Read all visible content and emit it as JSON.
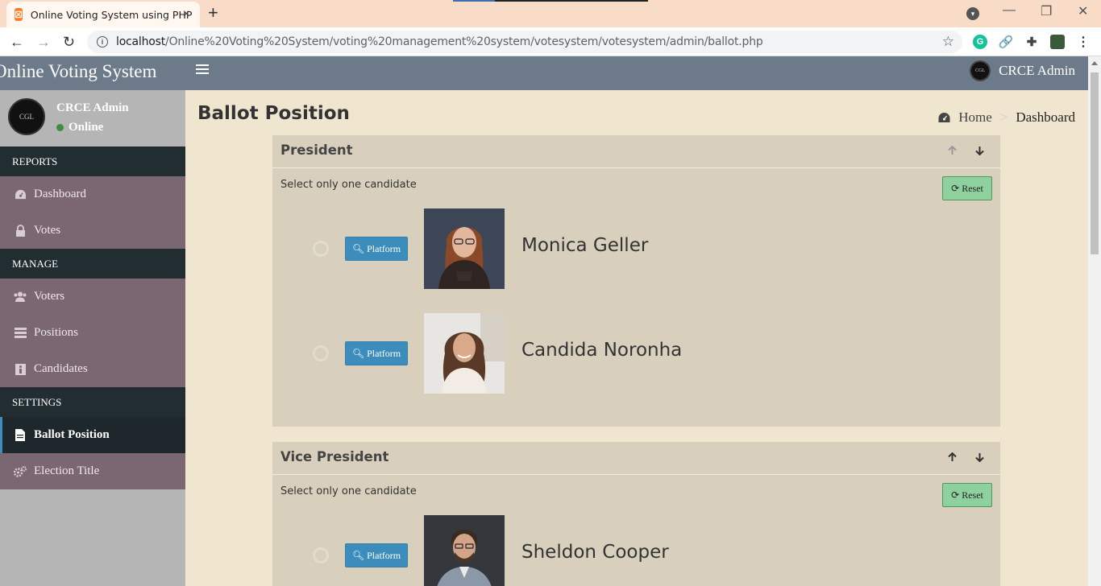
{
  "browser": {
    "tab_title": "Online Voting System using PHP",
    "url_host": "localhost",
    "url_path": "/Online%20Voting%20System/voting%20management%20system/votesystem/votesystem/admin/ballot.php"
  },
  "header": {
    "logo_text": "Online Voting System",
    "user_name": "CRCE Admin",
    "avatar_text": "CGL"
  },
  "sidebar": {
    "user_name": "CRCE Admin",
    "status": "Online",
    "avatar_text": "CGL",
    "sections": [
      {
        "title": "REPORTS",
        "items": [
          {
            "label": "Dashboard",
            "icon": "dashboard-icon"
          },
          {
            "label": "Votes",
            "icon": "lock-icon"
          }
        ]
      },
      {
        "title": "MANAGE",
        "items": [
          {
            "label": "Voters",
            "icon": "users-icon"
          },
          {
            "label": "Positions",
            "icon": "tasks-icon"
          },
          {
            "label": "Candidates",
            "icon": "id-card-icon"
          }
        ]
      },
      {
        "title": "SETTINGS",
        "items": [
          {
            "label": "Ballot Position",
            "icon": "file-icon"
          },
          {
            "label": "Election Title",
            "icon": "cogs-icon"
          }
        ]
      }
    ]
  },
  "content": {
    "title": "Ballot Position",
    "breadcrumb": {
      "home": "Home",
      "current": "Dashboard"
    }
  },
  "positions": [
    {
      "title": "President",
      "instructions": "Select only one candidate",
      "reset_label": "Reset",
      "candidates": [
        {
          "name": "Monica Geller",
          "platform_label": "Platform"
        },
        {
          "name": "Candida Noronha",
          "platform_label": "Platform"
        }
      ]
    },
    {
      "title": "Vice President",
      "instructions": "Select only one candidate",
      "reset_label": "Reset",
      "candidates": [
        {
          "name": "Sheldon Cooper",
          "platform_label": "Platform"
        }
      ]
    }
  ],
  "colors": {
    "header_bg": "#6c7a89",
    "sidebar_menu_bg": "#7a6772",
    "sidebar_section_bg": "#222d32",
    "content_bg": "#f0e6d0",
    "box_bg": "#d8d0bd",
    "platform_btn": "#3c8dbc",
    "reset_btn": "#8fd19e"
  }
}
